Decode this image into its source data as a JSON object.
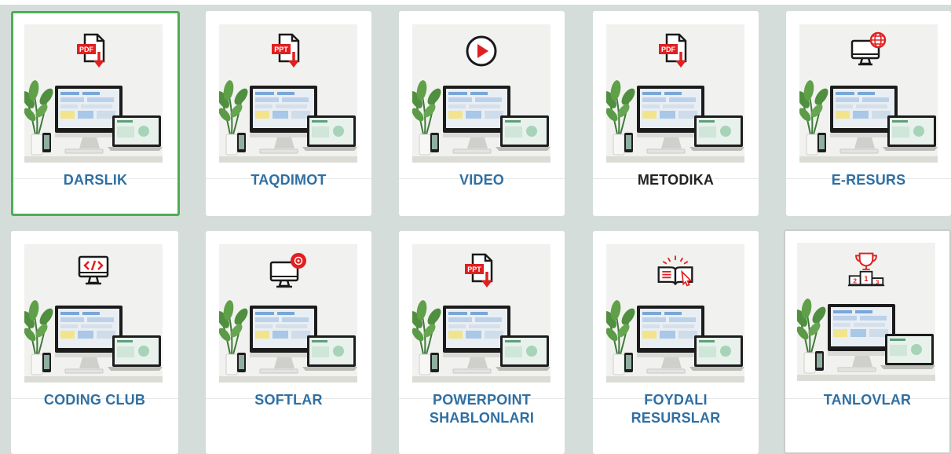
{
  "cards": [
    {
      "label": "DARSLIK",
      "icon": "pdf-download-icon",
      "badge": "PDF",
      "selected": true,
      "dark": false
    },
    {
      "label": "TAQDIMOT",
      "icon": "ppt-download-icon",
      "badge": "PPT",
      "selected": false,
      "dark": false
    },
    {
      "label": "VIDEO",
      "icon": "play-icon",
      "badge": "",
      "selected": false,
      "dark": false
    },
    {
      "label": "METODIKA",
      "icon": "pdf-download-icon",
      "badge": "PDF",
      "selected": false,
      "dark": true
    },
    {
      "label": "E-RESURS",
      "icon": "monitor-globe-icon",
      "badge": "",
      "selected": false,
      "dark": false
    },
    {
      "label": "CODING CLUB",
      "icon": "monitor-code-icon",
      "badge": "",
      "selected": false,
      "dark": false
    },
    {
      "label": "SOFTLAR",
      "icon": "monitor-disc-icon",
      "badge": "",
      "selected": false,
      "dark": false
    },
    {
      "label_lines": [
        "POWERPOINT",
        "SHABLONLARI"
      ],
      "icon": "ppt-download-icon",
      "badge": "PPT",
      "selected": false,
      "dark": false
    },
    {
      "label_lines": [
        "FOYDALI",
        "RESURSLAR"
      ],
      "icon": "open-book-icon",
      "badge": "",
      "selected": false,
      "dark": false
    },
    {
      "label": "TANLOVLAR",
      "icon": "trophy-podium-icon",
      "badge": "",
      "podium": [
        "2",
        "1",
        "3"
      ],
      "selected": false,
      "dark": false
    }
  ],
  "colors": {
    "accent_red": "#e02020",
    "label_blue": "#2f6fa3",
    "selected_border": "#4caf50",
    "background": "#d4ddd9"
  }
}
